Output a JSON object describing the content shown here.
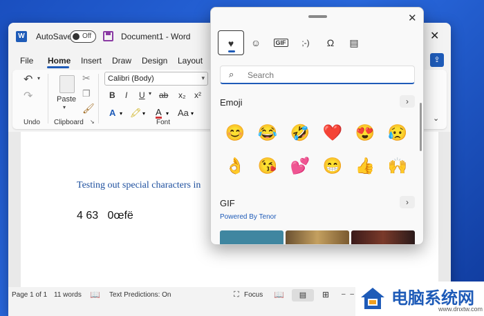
{
  "word": {
    "title_bar": {
      "autosave_label": "AutoSave",
      "toggle_state": "Off",
      "doc_title": "Document1 - Word"
    },
    "menu": [
      "File",
      "Home",
      "Insert",
      "Draw",
      "Design",
      "Layout"
    ],
    "ribbon": {
      "undo_group": "Undo",
      "clipboard_group": "Clipboard",
      "paste_label": "Paste",
      "font_name": "Calibri (Body)",
      "font_group": "Font",
      "bold": "B",
      "italic": "I",
      "underline": "U",
      "strike": "ab",
      "subscript": "x₂",
      "superscript": "x²",
      "font_color_label": "A",
      "font_size_label": "Aa"
    },
    "document": {
      "line1": "Testing out special characters in",
      "line2": "4 63   0œfë"
    },
    "status": {
      "page": "Page 1 of 1",
      "words": "11 words",
      "predictions": "Text Predictions: On",
      "focus": "Focus"
    }
  },
  "emoji_panel": {
    "tabs": [
      {
        "name": "emoji-tab",
        "glyph": "♥",
        "active": true
      },
      {
        "name": "kaomoji-smiley-tab",
        "glyph": "☺"
      },
      {
        "name": "gif-tab",
        "glyph": "GIF"
      },
      {
        "name": "kaomoji-tab",
        "glyph": ";-)"
      },
      {
        "name": "symbols-tab",
        "glyph": "Ω"
      },
      {
        "name": "clipboard-tab",
        "glyph": "▤"
      }
    ],
    "search_placeholder": "Search",
    "emoji_section": "Emoji",
    "emoji_row1": [
      "😊",
      "😂",
      "🤣",
      "❤️",
      "😍",
      "😥"
    ],
    "emoji_row2": [
      "👌",
      "😘",
      "💕",
      "😁",
      "👍",
      "🙌"
    ],
    "gif_section": "GIF",
    "gif_subtitle": "Powered By Tenor",
    "more_glyph": "›",
    "close_glyph": "✕"
  },
  "watermark": {
    "text": "电脑系统网",
    "url": "www.dnxtw.com"
  }
}
